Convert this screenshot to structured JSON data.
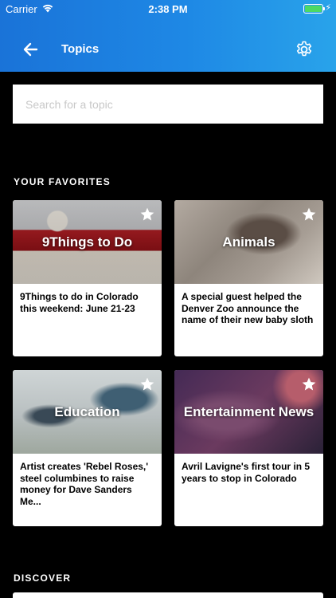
{
  "status_bar": {
    "carrier": "Carrier",
    "time": "2:38 PM",
    "battery_level": 1.0
  },
  "header": {
    "title": "Topics",
    "back_icon": "arrow-left-icon",
    "settings_icon": "gear-icon",
    "gradient_colors": [
      "#1a73d8",
      "#29a3ea"
    ]
  },
  "search": {
    "placeholder": "Search for a topic",
    "value": ""
  },
  "favorites": {
    "section_title": "YOUR FAVORITES",
    "cards": [
      {
        "topic": "9Things to Do",
        "headline": "9Things to do in Colorado this weekend: June 21-23",
        "starred": true
      },
      {
        "topic": "Animals",
        "headline": "A special guest helped the Denver Zoo announce the name of their new baby sloth",
        "starred": true
      },
      {
        "topic": "Education",
        "headline": "Artist creates 'Rebel Roses,' steel columbines to raise money for Dave Sanders Me...",
        "starred": true
      },
      {
        "topic": "Entertainment News",
        "headline": "Avril Lavigne's first tour in 5 years to stop in Colorado",
        "starred": true
      }
    ]
  },
  "discover": {
    "section_title": "DISCOVER"
  }
}
